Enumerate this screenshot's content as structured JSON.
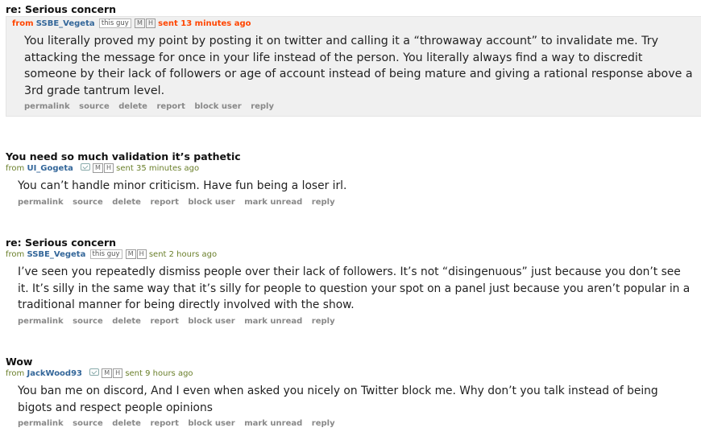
{
  "messages": [
    {
      "subject": "re: Serious concern",
      "from_label": "from",
      "author": "SSBE_Vegeta",
      "this_guy": "this guy",
      "m": "M",
      "h": "H",
      "sent": "sent 13 minutes ago",
      "body": "You literally proved my point by posting it on twitter and calling it a “throwaway account” to invalidate me. Try attacking the message for once in your life instead of the person. You literally always find a way to discredit someone by their lack of followers or age of account instead of being mature and giving a rational response above a 3rd grade tantrum level.",
      "buttons": [
        "permalink",
        "source",
        "delete",
        "report",
        "block user",
        "reply"
      ]
    },
    {
      "subject": "You need so much validation it’s pathetic",
      "from_label": "from",
      "author": "UI_Gogeta",
      "m": "M",
      "h": "H",
      "sent": "sent 35 minutes ago",
      "body": "You can’t handle minor criticism. Have fun being a loser irl.",
      "buttons": [
        "permalink",
        "source",
        "delete",
        "report",
        "block user",
        "mark unread",
        "reply"
      ]
    },
    {
      "subject": "re: Serious concern",
      "from_label": "from",
      "author": "SSBE_Vegeta",
      "this_guy": "this guy",
      "m": "M",
      "h": "H",
      "sent": "sent 2 hours ago",
      "body": "I’ve seen you repeatedly dismiss people over their lack of followers. It’s not “disingenuous” just because you don’t see it. It’s silly in the same way that it’s silly for people to question your spot on a panel just because you aren’t popular in a traditional manner for being directly involved with the show.",
      "buttons": [
        "permalink",
        "source",
        "delete",
        "report",
        "block user",
        "mark unread",
        "reply"
      ]
    },
    {
      "subject": "Wow",
      "from_label": "from",
      "author": "JackWood93",
      "m": "M",
      "h": "H",
      "sent": "sent 9 hours ago",
      "body": "You ban me on discord, And I even when asked you nicely on Twitter block me. Why don’t you talk instead of being bigots and respect people opinions",
      "buttons": [
        "permalink",
        "source",
        "delete",
        "report",
        "block user",
        "mark unread",
        "reply"
      ]
    }
  ]
}
